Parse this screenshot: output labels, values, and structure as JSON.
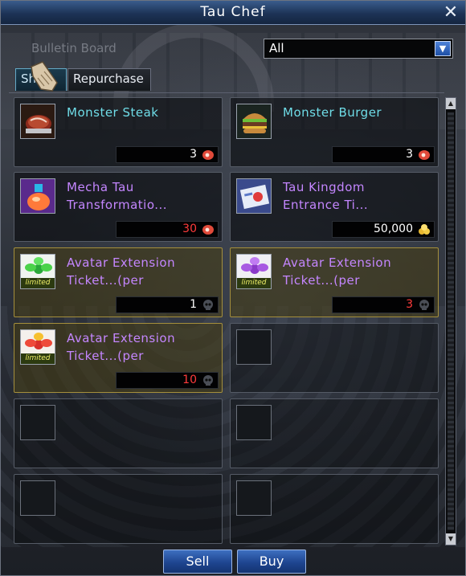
{
  "window": {
    "title": "Tau Chef"
  },
  "background_text": {
    "bulletin_board": "Bulletin Board"
  },
  "filter": {
    "selected": "All"
  },
  "tabs": [
    {
      "label": "Shop",
      "active": true
    },
    {
      "label": "Repurchase",
      "active": false
    }
  ],
  "items": [
    {
      "name_line1": "Monster Steak",
      "name_line2": "",
      "price": "3",
      "price_color": "white",
      "currency": "meat-icon",
      "limited": false,
      "name_color": "#6fdde8",
      "icon": "steak-icon"
    },
    {
      "name_line1": "Monster Burger",
      "name_line2": "",
      "price": "3",
      "price_color": "white",
      "currency": "meat-icon",
      "limited": false,
      "name_color": "#6fdde8",
      "icon": "burger-icon"
    },
    {
      "name_line1": "Mecha Tau",
      "name_line2": "Transformatio...",
      "price": "30",
      "price_color": "red",
      "currency": "meat-icon",
      "limited": false,
      "name_color": "#c486ff",
      "icon": "potion-icon"
    },
    {
      "name_line1": "Tau Kingdom",
      "name_line2": "Entrance Ti...",
      "price": "50,000",
      "price_color": "white",
      "currency": "gold-coin-icon",
      "limited": false,
      "name_color": "#c486ff",
      "icon": "ticket-icon"
    },
    {
      "name_line1": "Avatar Extension",
      "name_line2": "Ticket...(per",
      "price": "1",
      "price_color": "white",
      "currency": "skull-icon",
      "limited": true,
      "limited_label": "limited",
      "name_color": "#c486ff",
      "icon": "green-ribbon-icon"
    },
    {
      "name_line1": "Avatar Extension",
      "name_line2": "Ticket...(per",
      "price": "3",
      "price_color": "red",
      "currency": "skull-icon",
      "limited": true,
      "limited_label": "limited",
      "name_color": "#c486ff",
      "icon": "purple-ribbon-icon"
    },
    {
      "name_line1": "Avatar Extension",
      "name_line2": "Ticket...(per",
      "price": "10",
      "price_color": "red",
      "currency": "skull-icon",
      "limited": true,
      "limited_label": "limited",
      "name_color": "#c486ff",
      "icon": "red-ribbon-icon"
    }
  ],
  "buttons": {
    "sell": "Sell",
    "buy": "Buy"
  },
  "colors": {
    "name_cyan": "#6fdde8",
    "name_purple": "#c486ff",
    "price_red": "#ff3b3b",
    "limited_border": "#a58f3c",
    "button_blue": "#1e4590"
  }
}
